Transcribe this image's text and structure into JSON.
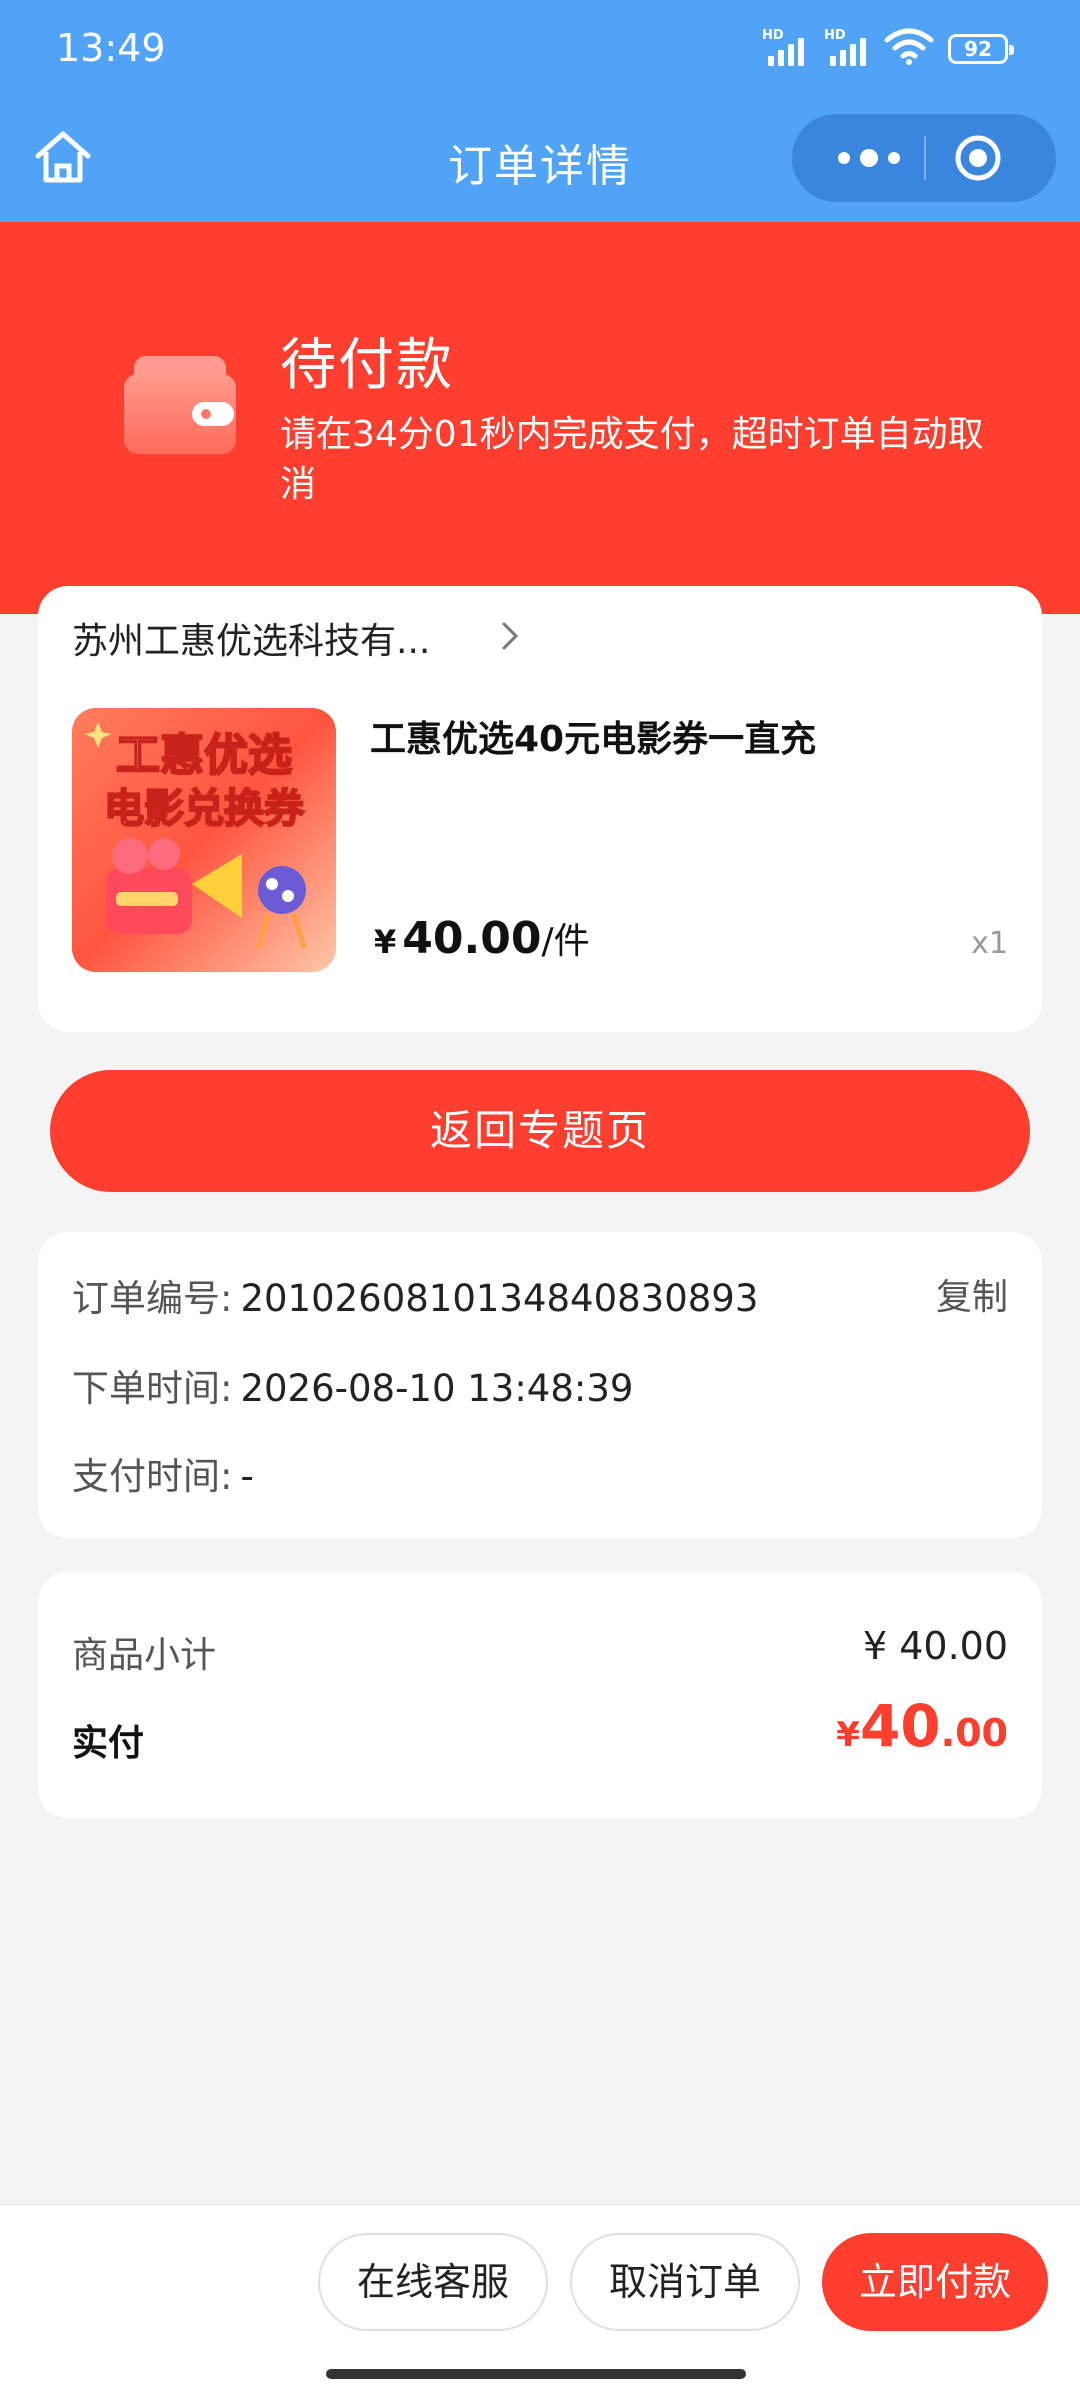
{
  "status_bar": {
    "time": "13:49",
    "battery": "92",
    "signal_label_1": "HD",
    "signal_label_2": "HD"
  },
  "nav": {
    "title": "订单详情",
    "home_icon": "home-icon",
    "more_icon": "more-dots-icon",
    "close_icon": "target-close-icon"
  },
  "banner": {
    "status": "待付款",
    "description": "请在34分01秒内完成支付，超时订单自动取消",
    "icon": "wallet-icon",
    "color": "#fe3e2e"
  },
  "product_card": {
    "shop_name": "苏州工惠优选科技有...",
    "product_title": "工惠优选40元电影券一直充",
    "thumbnail_text_line1": "工惠优选",
    "thumbnail_text_line2": "电影兑换券",
    "price_symbol": "¥",
    "price": "40.00",
    "price_unit": "/件",
    "quantity": "x1"
  },
  "back_button": {
    "label": "返回专题页"
  },
  "order_info": {
    "order_no_label": "订单编号:",
    "order_no": "20102608101348408 30893",
    "order_no_full": "201026081013484083 0893",
    "copy_label": "复制",
    "order_time_label": "下单时间:",
    "order_time": "2026-08-10 13:48:39",
    "pay_time_label": "支付时间:",
    "pay_time": "-"
  },
  "amount": {
    "subtotal_label": "商品小计",
    "subtotal": "¥ 40.00",
    "paid_label": "实付",
    "paid_symbol": "¥",
    "paid_int": "40",
    "paid_dec": ".00"
  },
  "bottom_bar": {
    "service_label": "在线客服",
    "cancel_label": "取消订单",
    "pay_label": "立即付款"
  },
  "colors": {
    "nav_blue": "#51a3f6",
    "accent_red": "#fe3e2e"
  }
}
